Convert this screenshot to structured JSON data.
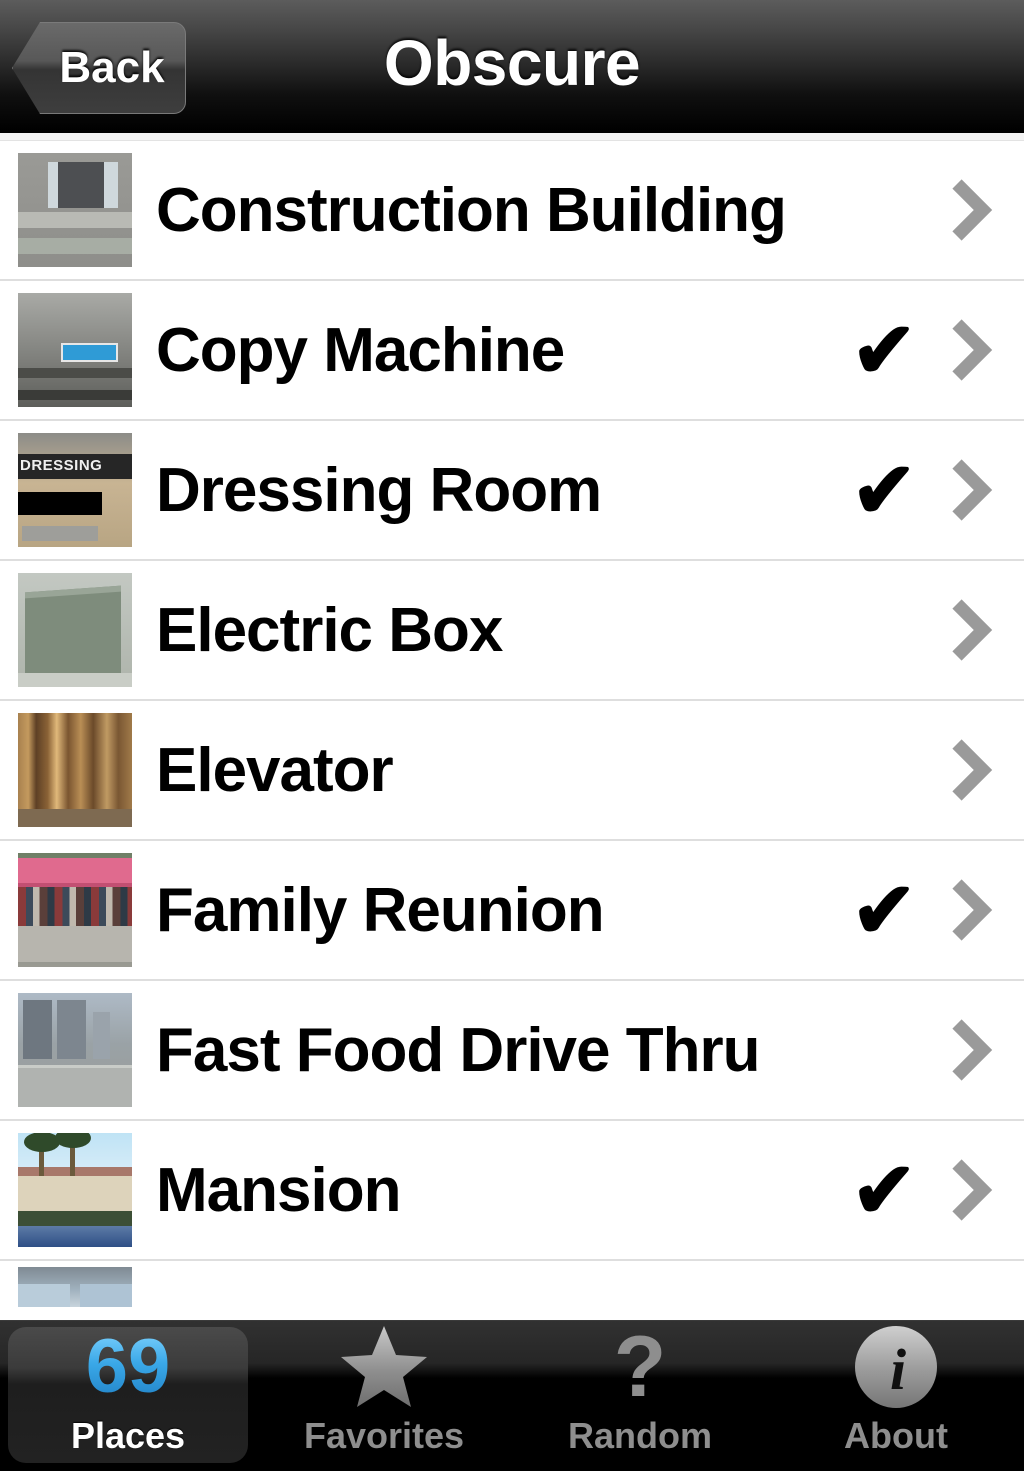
{
  "navbar": {
    "back_label": "Back",
    "title": "Obscure"
  },
  "list": {
    "rows": [
      {
        "title": "Construction Building",
        "checked": false,
        "checkmark": "✔",
        "chevron": "›",
        "thumb": "construction-building-thumbnail"
      },
      {
        "title": "Copy Machine",
        "checked": true,
        "checkmark": "✔",
        "chevron": "›",
        "thumb": "copy-machine-thumbnail"
      },
      {
        "title": "Dressing Room",
        "checked": true,
        "checkmark": "✔",
        "chevron": "›",
        "thumb": "dressing-room-thumbnail",
        "thumb_sign_text": "DRESSING"
      },
      {
        "title": "Electric Box",
        "checked": false,
        "checkmark": "✔",
        "chevron": "›",
        "thumb": "electric-box-thumbnail"
      },
      {
        "title": "Elevator",
        "checked": false,
        "checkmark": "✔",
        "chevron": "›",
        "thumb": "elevator-thumbnail"
      },
      {
        "title": "Family Reunion",
        "checked": true,
        "checkmark": "✔",
        "chevron": "›",
        "thumb": "family-reunion-thumbnail"
      },
      {
        "title": "Fast Food Drive Thru",
        "checked": false,
        "checkmark": "✔",
        "chevron": "›",
        "thumb": "fast-food-drive-thru-thumbnail"
      },
      {
        "title": "Mansion",
        "checked": true,
        "checkmark": "✔",
        "chevron": "›",
        "thumb": "mansion-thumbnail"
      }
    ]
  },
  "tabbar": {
    "tabs": [
      {
        "label": "Places",
        "icon": "count-badge",
        "badge": "69",
        "active": true
      },
      {
        "label": "Favorites",
        "icon": "star-icon",
        "badge": "",
        "active": false
      },
      {
        "label": "Random",
        "icon": "question-mark-icon",
        "badge": "?",
        "active": false
      },
      {
        "label": "About",
        "icon": "info-circle-icon",
        "badge": "",
        "active": false
      }
    ]
  },
  "colors": {
    "accent_blue": "#3aa8e8",
    "chevron_gray": "#9a9a9a",
    "inactive_tab_gray": "#8e8e8e",
    "separator": "#dedede",
    "nav_bottom": "#000000"
  }
}
